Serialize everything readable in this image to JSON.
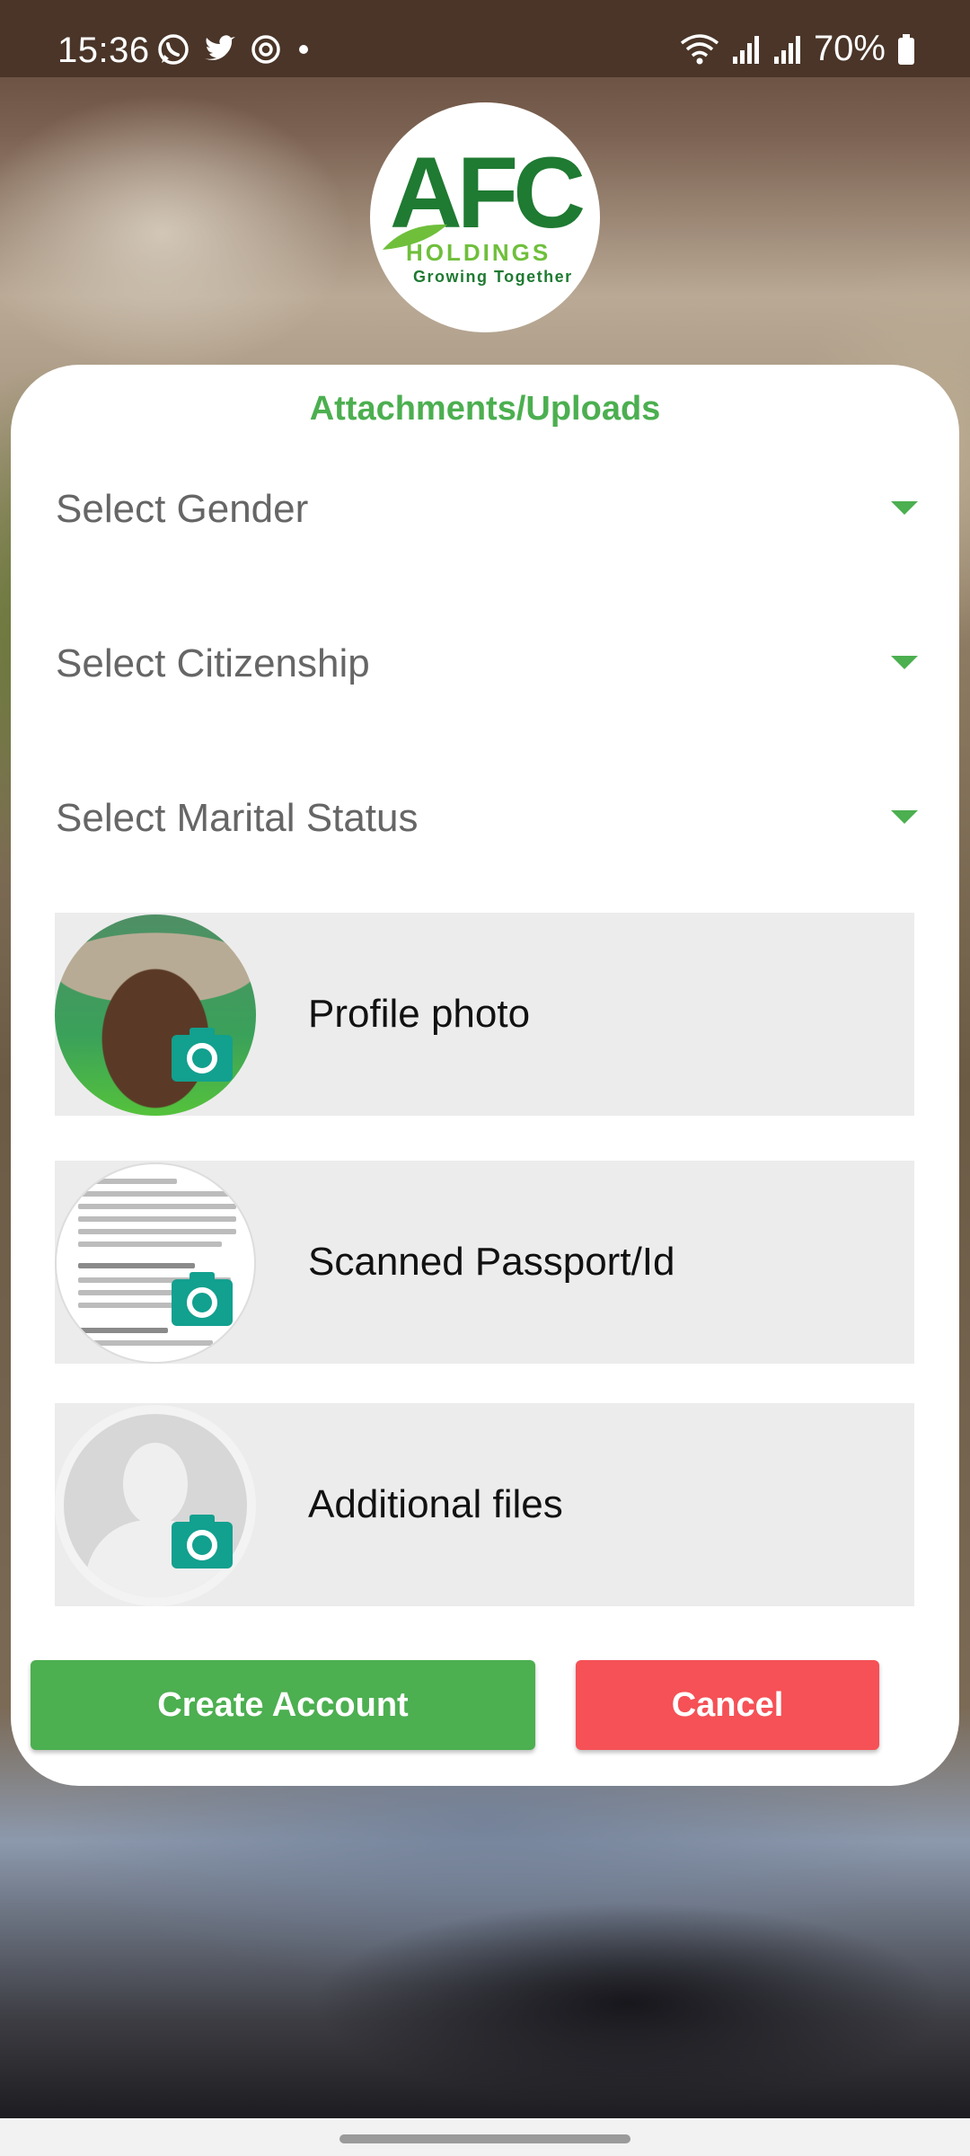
{
  "status_bar": {
    "time": "15:36",
    "battery": "70%",
    "left_icons": [
      "whatsapp-icon",
      "twitter-icon",
      "sync-icon",
      "dot-icon"
    ],
    "right_icons": [
      "wifi-icon",
      "signal-icon",
      "signal-icon",
      "battery-icon"
    ]
  },
  "logo": {
    "brand": "AFC",
    "holdings": "HOLDINGS",
    "tagline": "Growing Together"
  },
  "card": {
    "title": "Attachments/Uploads",
    "selects": [
      {
        "label": "Select Gender"
      },
      {
        "label": "Select Citizenship"
      },
      {
        "label": "Select Marital Status"
      }
    ],
    "uploads": [
      {
        "label": "Profile photo",
        "icon": "camera-icon"
      },
      {
        "label": "Scanned Passport/Id",
        "icon": "camera-icon"
      },
      {
        "label": "Additional files",
        "icon": "camera-icon"
      }
    ]
  },
  "buttons": {
    "create": "Create Account",
    "cancel": "Cancel"
  },
  "colors": {
    "accent": "#4caf50",
    "danger": "#f55156",
    "upload_bg": "#ececec",
    "camera": "#12a08f"
  }
}
